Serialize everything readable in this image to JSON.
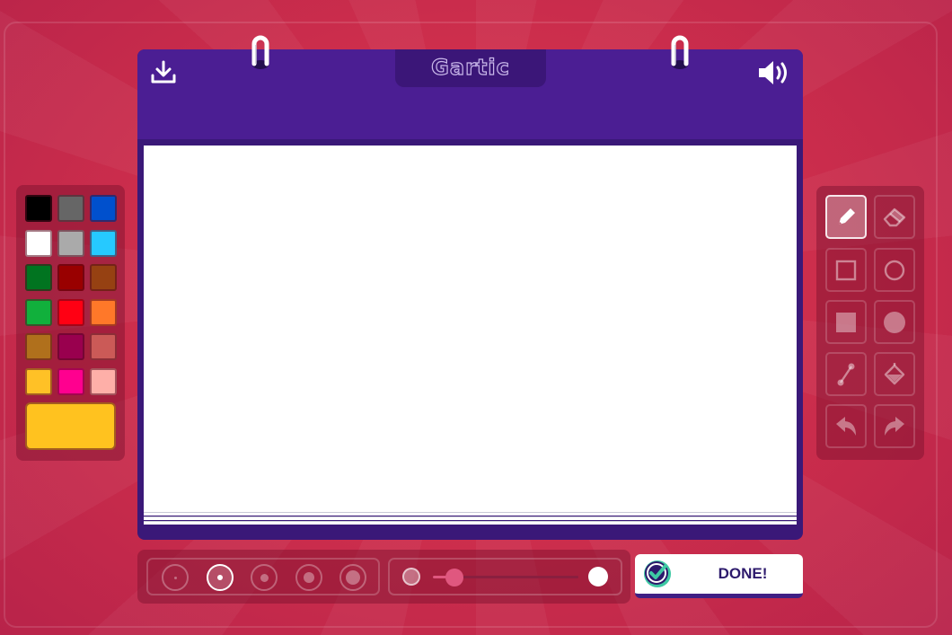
{
  "app": {
    "title": "Gartic"
  },
  "colors": {
    "background": "#d23650",
    "board": "#4b1e93",
    "canvas": "#ffffff",
    "done_text": "#2d1a6c",
    "selected_color": "#ffc21f"
  },
  "palette": {
    "swatches": [
      {
        "name": "black",
        "hex": "#000000"
      },
      {
        "name": "dark-gray",
        "hex": "#666666"
      },
      {
        "name": "blue",
        "hex": "#0050cd"
      },
      {
        "name": "white",
        "hex": "#ffffff"
      },
      {
        "name": "light-gray",
        "hex": "#aaaaaa"
      },
      {
        "name": "sky-blue",
        "hex": "#26c9ff"
      },
      {
        "name": "dark-green",
        "hex": "#017420"
      },
      {
        "name": "dark-red",
        "hex": "#990000"
      },
      {
        "name": "brown",
        "hex": "#964112"
      },
      {
        "name": "green",
        "hex": "#11b03c"
      },
      {
        "name": "red",
        "hex": "#ff0013"
      },
      {
        "name": "orange",
        "hex": "#ff7829"
      },
      {
        "name": "ochre",
        "hex": "#b0701c"
      },
      {
        "name": "maroon",
        "hex": "#99004e"
      },
      {
        "name": "salmon",
        "hex": "#cb5a57"
      },
      {
        "name": "yellow",
        "hex": "#ffc126"
      },
      {
        "name": "magenta",
        "hex": "#ff008f"
      },
      {
        "name": "pink",
        "hex": "#feafa8"
      }
    ],
    "current": "#ffc21f"
  },
  "header": {
    "download_icon": "download-icon",
    "sound_icon": "speaker-icon"
  },
  "tools": [
    {
      "name": "pencil",
      "icon": "pencil-icon",
      "active": true
    },
    {
      "name": "eraser",
      "icon": "eraser-icon",
      "active": false
    },
    {
      "name": "rectangle-outline",
      "icon": "square-outline-icon",
      "active": false
    },
    {
      "name": "ellipse-outline",
      "icon": "circle-outline-icon",
      "active": false
    },
    {
      "name": "rectangle-fill",
      "icon": "square-filled-icon",
      "active": false
    },
    {
      "name": "ellipse-fill",
      "icon": "circle-filled-icon",
      "active": false
    },
    {
      "name": "line",
      "icon": "line-icon",
      "active": false
    },
    {
      "name": "fill-bucket",
      "icon": "bucket-icon",
      "active": false
    },
    {
      "name": "undo",
      "icon": "undo-icon",
      "active": false
    },
    {
      "name": "redo",
      "icon": "redo-icon",
      "active": false
    }
  ],
  "brush_sizes": {
    "count": 5,
    "selected_index": 1
  },
  "opacity": {
    "value": 0.15
  },
  "done_button": {
    "label": "DONE!",
    "icon": "check-badge-icon"
  }
}
